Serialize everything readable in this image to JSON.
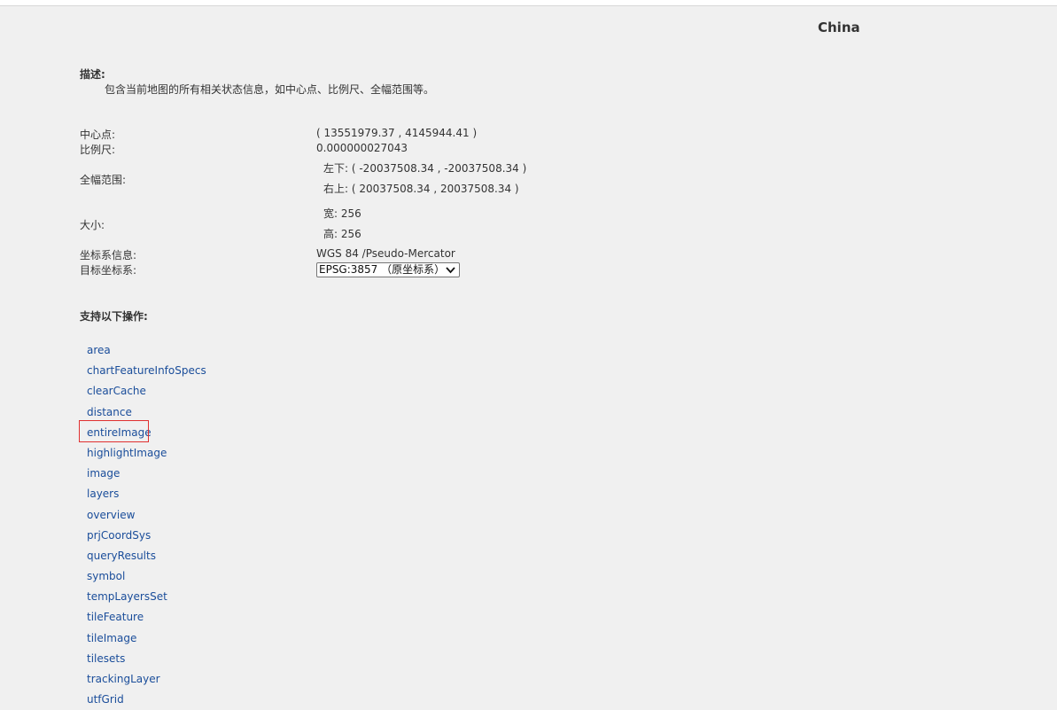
{
  "header": {
    "title": "China"
  },
  "description": {
    "label": "描述:",
    "text": "包含当前地图的所有相关状态信息，如中心点、比例尺、全幅范围等。"
  },
  "info": {
    "center_label": "中心点:",
    "center_value": "( 13551979.37 , 4145944.41 )",
    "scale_label": "比例尺:",
    "scale_value": "0.000000027043",
    "bounds_label": "全幅范围:",
    "bounds_lower": "左下:  ( -20037508.34 , -20037508.34 )",
    "bounds_upper": "右上:  ( 20037508.34 , 20037508.34 )",
    "size_label": "大小:",
    "size_width": "宽: 256",
    "size_height": "高: 256",
    "crs_label": "坐标系信息:",
    "crs_value": "WGS 84 /Pseudo-Mercator",
    "target_crs_label": "目标坐标系:",
    "target_crs_selected": "EPSG:3857 （原坐标系）"
  },
  "operations": {
    "label": "支持以下操作:",
    "items": [
      "area",
      "chartFeatureInfoSpecs",
      "clearCache",
      "distance",
      "entireImage",
      "highlightImage",
      "image",
      "layers",
      "overview",
      "prjCoordSys",
      "queryResults",
      "symbol",
      "tempLayersSet",
      "tileFeature",
      "tileImage",
      "tilesets",
      "trackingLayer",
      "utfGrid"
    ],
    "highlighted": "entireImage"
  }
}
